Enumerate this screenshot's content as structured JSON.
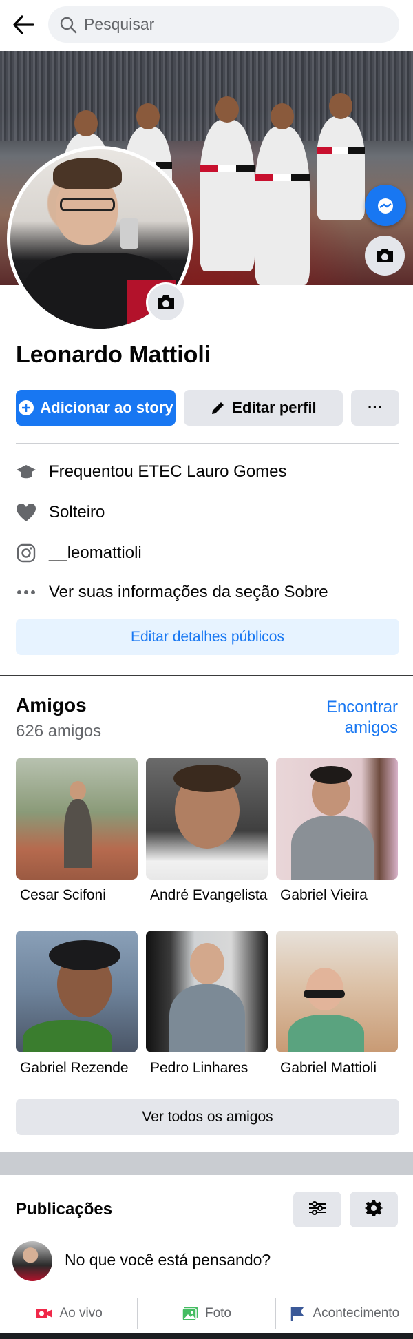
{
  "search": {
    "placeholder": "Pesquisar"
  },
  "profile": {
    "name": "Leonardo Mattioli",
    "add_story_label": "Adicionar ao story",
    "edit_profile_label": "Editar perfil",
    "more_label": "···"
  },
  "info": [
    {
      "icon": "education-icon",
      "text": "Frequentou ETEC Lauro Gomes"
    },
    {
      "icon": "heart-icon",
      "text": "Solteiro"
    },
    {
      "icon": "instagram-icon",
      "text": "__leomattioli"
    },
    {
      "icon": "more-dots-icon",
      "text": "Ver suas informações da seção Sobre"
    }
  ],
  "edit_public_details_label": "Editar detalhes públicos",
  "friends": {
    "title": "Amigos",
    "count": "626 amigos",
    "find_label": "Encontrar amigos",
    "items": [
      {
        "name": "Cesar Scifoni"
      },
      {
        "name": "André Evangelista"
      },
      {
        "name": "Gabriel Vieira"
      },
      {
        "name": "Gabriel Rezende"
      },
      {
        "name": "Pedro Linhares"
      },
      {
        "name": "Gabriel Mattioli"
      }
    ],
    "see_all_label": "Ver todos os amigos"
  },
  "posts": {
    "title": "Publicações",
    "composer_placeholder": "No que você está pensando?"
  },
  "bottom_actions": [
    {
      "icon": "live-video-icon",
      "label": "Ao vivo"
    },
    {
      "icon": "photo-icon",
      "label": "Foto"
    },
    {
      "icon": "flag-icon",
      "label": "Acontecimento"
    }
  ],
  "colors": {
    "accent": "#1877f2",
    "button_gray": "#e4e6eb",
    "light_blue": "#e7f3ff",
    "live_red": "#f02849",
    "photo_green": "#45bd62"
  }
}
